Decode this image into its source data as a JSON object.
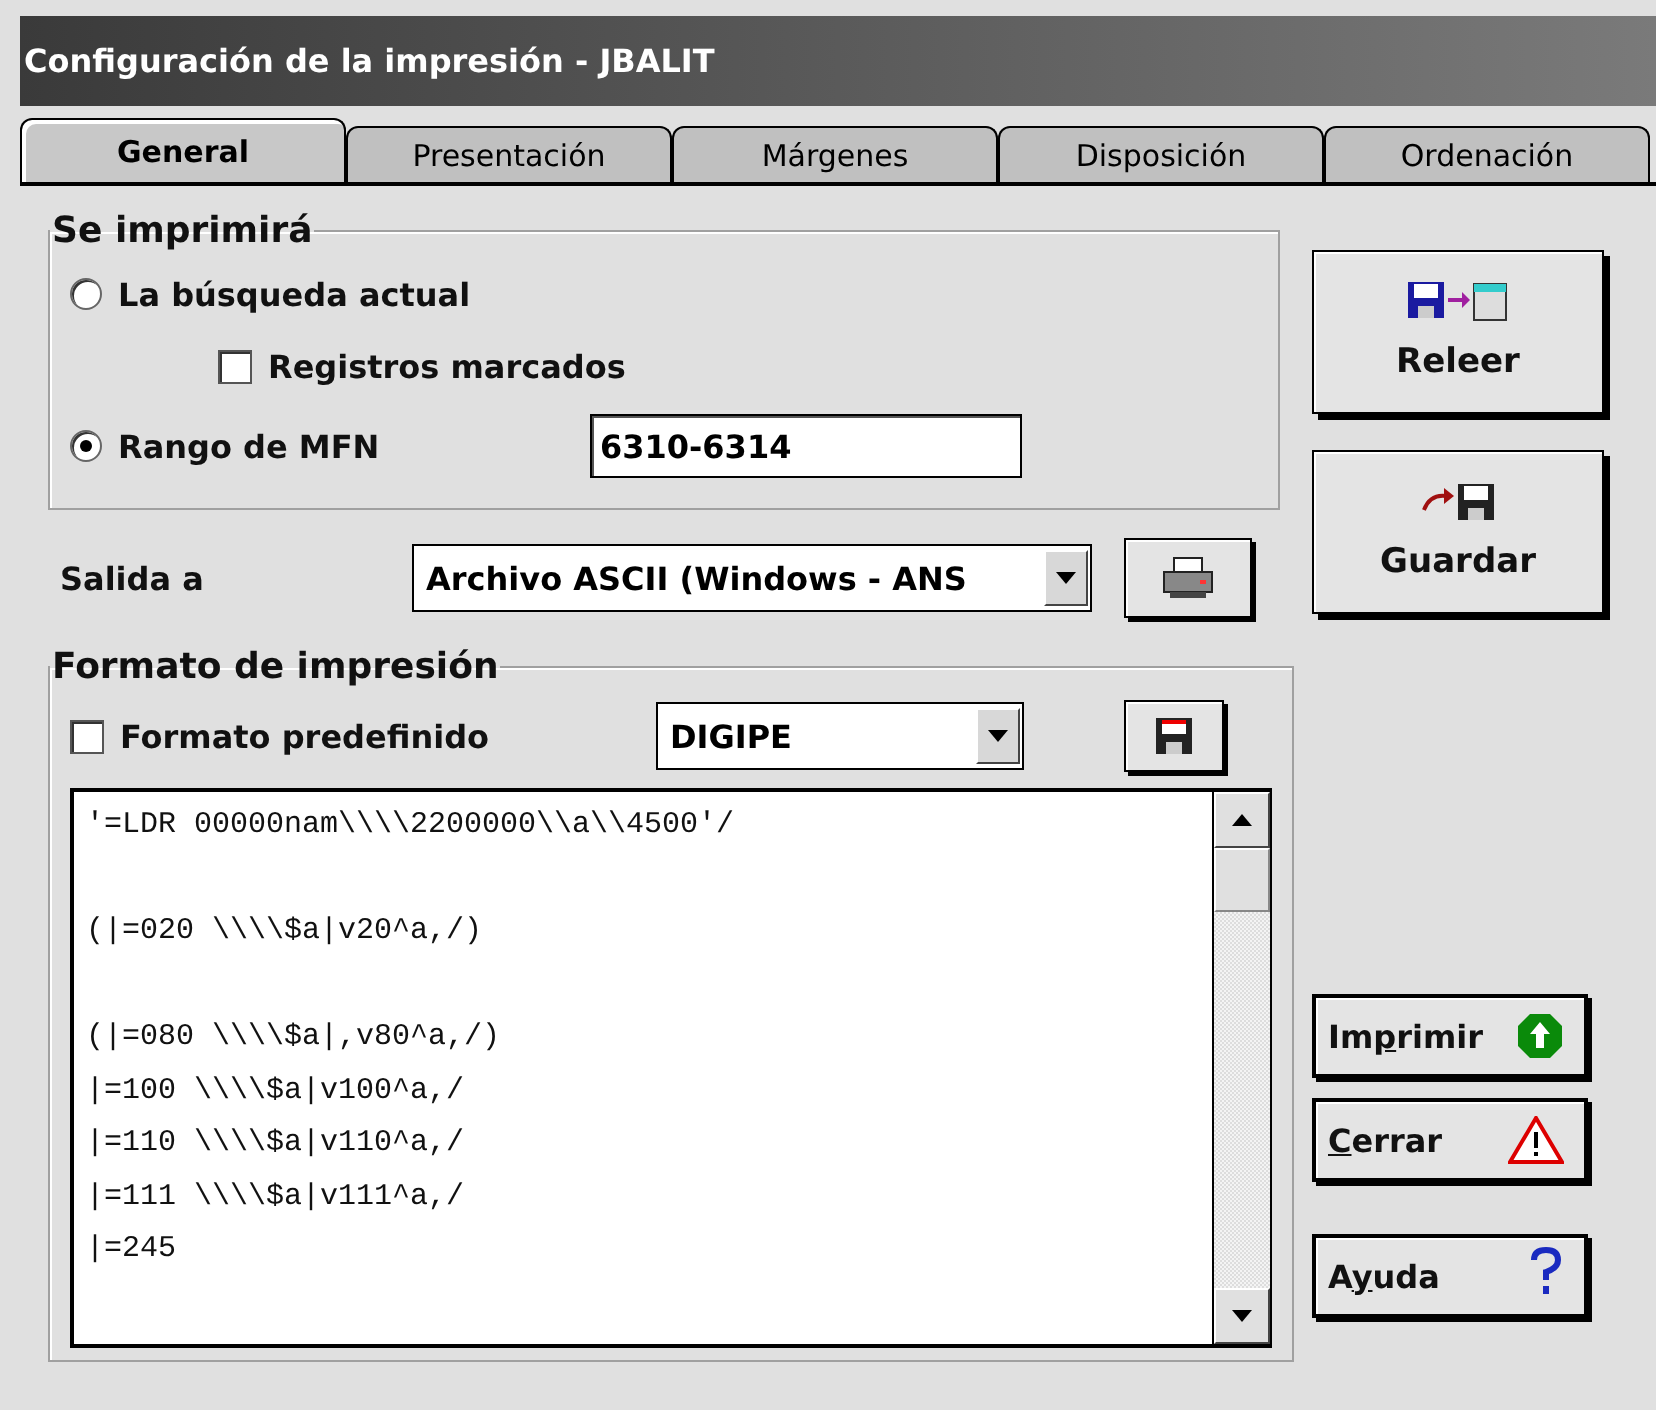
{
  "window": {
    "title": "Configuración de la impresión - JBALIT"
  },
  "tabs": [
    {
      "label": "General",
      "selected": true
    },
    {
      "label": "Presentación",
      "selected": false
    },
    {
      "label": "Márgenes",
      "selected": false
    },
    {
      "label": "Disposición",
      "selected": false
    },
    {
      "label": "Ordenación",
      "selected": false
    }
  ],
  "print_scope": {
    "legend": "Se imprimirá",
    "current_search": {
      "label": "La búsqueda actual",
      "selected": false
    },
    "marked_records": {
      "label": "Registros marcados",
      "checked": false
    },
    "mfn_range": {
      "label": "Rango de MFN",
      "selected": true,
      "value": "6310-6314"
    }
  },
  "output": {
    "label": "Salida a",
    "value": "Archivo ASCII (Windows - ANS"
  },
  "format": {
    "legend": "Formato de impresión",
    "predefined": {
      "label": "Formato predefinido",
      "checked": false
    },
    "format_name": "DIGIPE",
    "code_lines": [
      {
        "kind": "code",
        "text": "'=LDR 00000nam\\\\\\\\2200000\\\\a\\\\4500'/"
      },
      {
        "kind": "blank"
      },
      {
        "kind": "code",
        "text": "(|=020 \\\\\\\\$a|v20^a,/)"
      },
      {
        "kind": "blank"
      },
      {
        "kind": "code",
        "text": "(|=080 \\\\\\\\$a|,v80^a,/)"
      },
      {
        "kind": "code",
        "text": "|=100 \\\\\\\\$a|v100^a,/"
      },
      {
        "kind": "code",
        "text": "|=110 \\\\\\\\$a|v110^a,/"
      },
      {
        "kind": "code",
        "text": "|=111 \\\\\\\\$a|v111^a,/"
      },
      {
        "kind": "code",
        "text": "|=245"
      }
    ]
  },
  "side_buttons": [
    {
      "kind": "reload",
      "label": "Releer"
    },
    {
      "kind": "save",
      "label": "Guardar"
    }
  ],
  "action_buttons": [
    {
      "kind": "print",
      "before": "Im",
      "key": "p",
      "after": "rimir"
    },
    {
      "kind": "close",
      "key": "C",
      "after": "errar"
    },
    {
      "kind": "help",
      "before": "A",
      "key": "y",
      "after": "uda"
    }
  ]
}
